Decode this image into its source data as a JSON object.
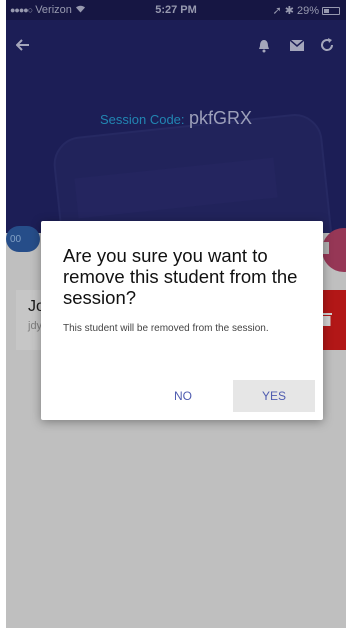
{
  "status_bar": {
    "signal": "●●●●○",
    "carrier": "Verizon",
    "wifi_icon": "wifi-icon",
    "time": "5:27 PM",
    "battery_percent": "29%"
  },
  "header": {
    "session_code_label": "Session Code:",
    "session_code_value": "pkfGRX",
    "icons": [
      "back-arrow-icon",
      "bell-icon",
      "mail-icon",
      "refresh-icon"
    ]
  },
  "background": {
    "pill_text": "00",
    "student_name": "Jo",
    "student_sub": "jdy"
  },
  "dialog": {
    "title": "Are you sure you want to remove this student from the session?",
    "message": "This student will be removed from the session.",
    "no_label": "NO",
    "yes_label": "YES"
  },
  "colors": {
    "header_bg": "#23256a",
    "session_label": "#2aa3d9",
    "button_text": "#4f5cb0",
    "delete_red": "#d91d1d"
  }
}
